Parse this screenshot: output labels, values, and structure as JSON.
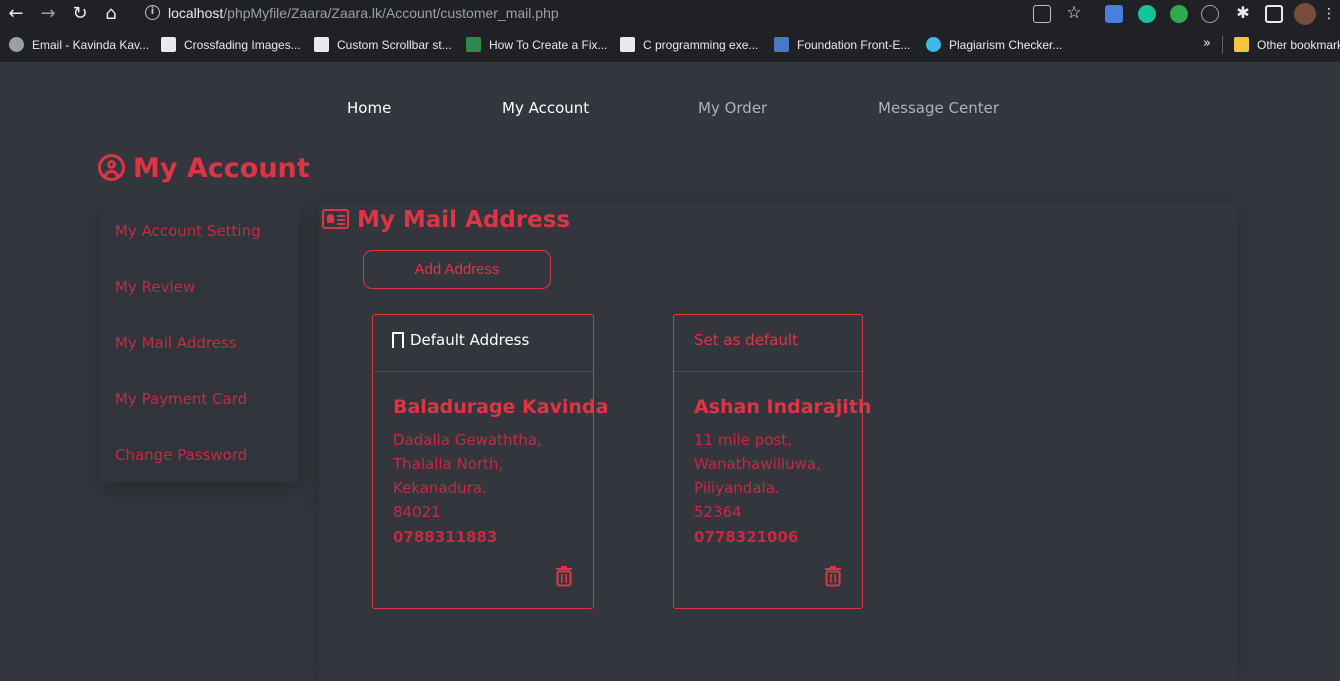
{
  "browser": {
    "url_host": "localhost",
    "url_path": "/phpMyfile/Zaara/Zaara.lk/Account/customer_mail.php",
    "bookmarks": [
      "Email - Kavinda Kav...",
      "Crossfading Images...",
      "Custom Scrollbar st...",
      "How To Create a Fix...",
      "C programming exe...",
      "Foundation Front-E...",
      "Plagiarism Checker..."
    ],
    "other_bookmarks": "Other bookmarks",
    "more": "»"
  },
  "nav": {
    "items": [
      {
        "label": "Home",
        "color": "#ffffff"
      },
      {
        "label": "My Account",
        "color": "#ffffff"
      },
      {
        "label": "My Order",
        "color": "#aeb2b8"
      },
      {
        "label": "Message Center",
        "color": "#aeb2b8"
      }
    ]
  },
  "page": {
    "title": "My Account"
  },
  "sidebar": {
    "items": [
      {
        "label": "My Account Setting"
      },
      {
        "label": "My Review"
      },
      {
        "label": "My Mail Address"
      },
      {
        "label": "My Payment Card"
      },
      {
        "label": "Change Password"
      }
    ]
  },
  "section": {
    "title": "My Mail Address",
    "add_button": "Add Address"
  },
  "addresses": [
    {
      "header": "Default Address",
      "name": "Baladurage Kavinda",
      "lines": [
        "Dadalla Gewaththa,",
        "Thalalla North,",
        "Kekanadura.",
        "84021"
      ],
      "phone": "0788311883"
    },
    {
      "header": "Set as default",
      "name": "Ashan Indarajith",
      "lines": [
        "11 mile post,",
        "Wanathawilluwa,",
        "Piliyandala.",
        "52364"
      ],
      "phone": "0778321006"
    }
  ],
  "colors": {
    "accent": "#dc3545",
    "background": "#33373d"
  }
}
